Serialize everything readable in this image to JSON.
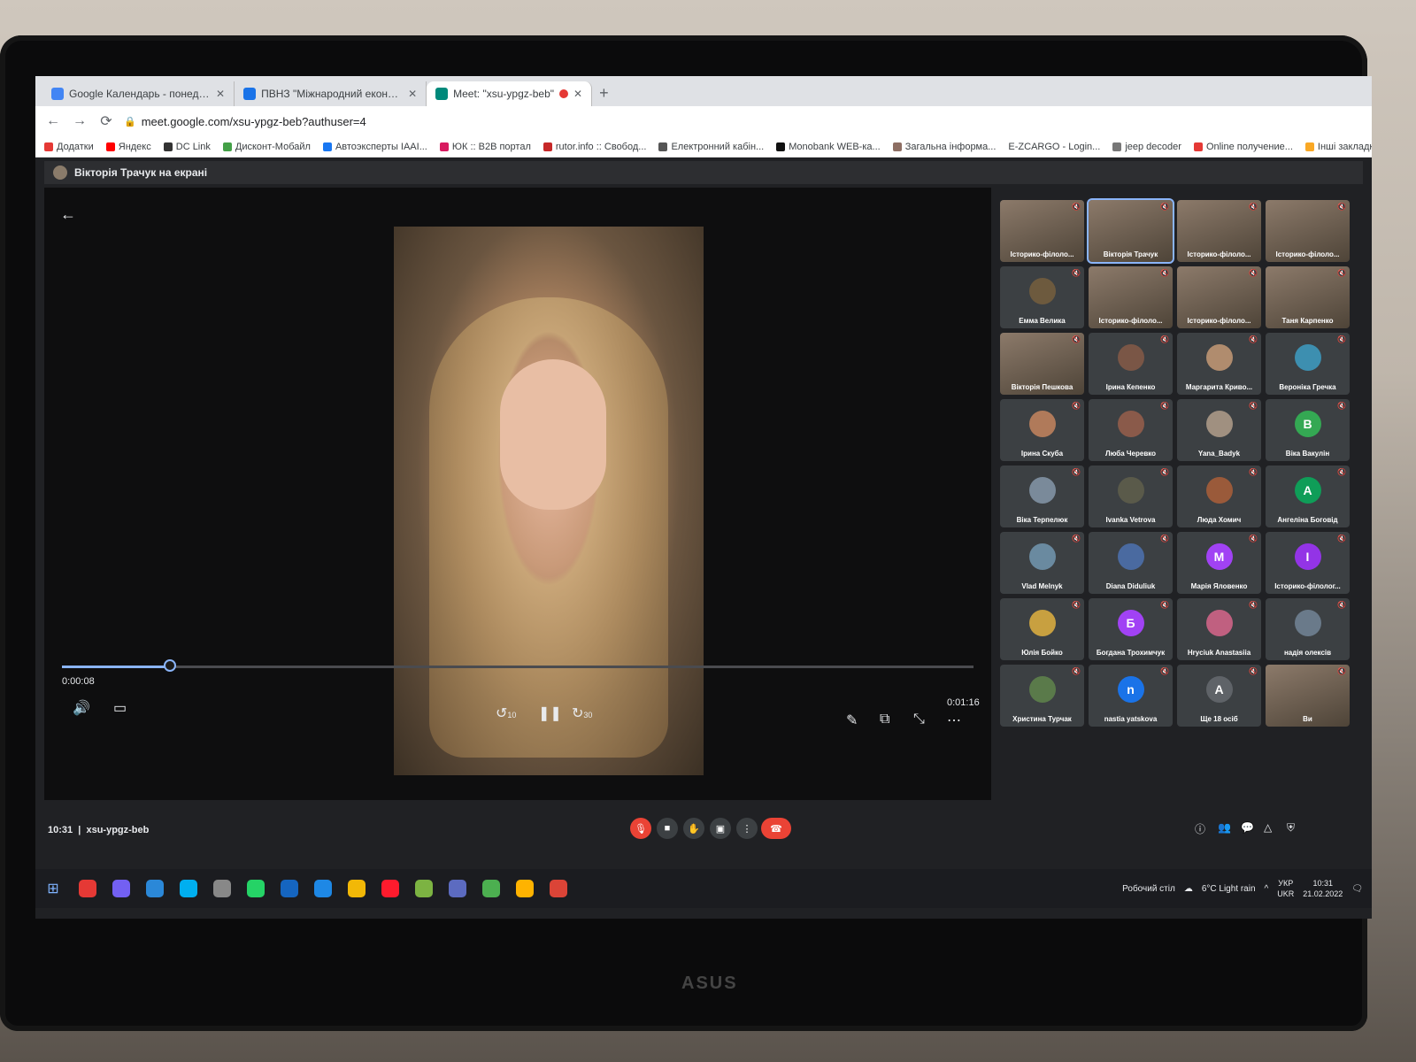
{
  "browser": {
    "tabs": [
      {
        "title": "Google Календарь - понедельн...",
        "color": "#4285f4"
      },
      {
        "title": "ПВНЗ \"Міжнародний економіко...",
        "color": "#1a73e8"
      },
      {
        "title": "Meet: \"xsu-ypgz-beb\"",
        "color": "#00897b"
      }
    ],
    "url": "meet.google.com/xsu-ypgz-beb?authuser=4",
    "bookmarks": [
      "Додатки",
      "Яндекс",
      "DC Link",
      "Дисконт-Мобайл",
      "Автоэксперты IAAI...",
      "ЮК :: B2B портал",
      "rutor.info :: Свобод...",
      "Електронний кабін...",
      "Monobank WEB-ка...",
      "Загальна інформа...",
      "E-ZCARGO - Login...",
      "jeep decoder",
      "Online получение...",
      "Інші закладки"
    ]
  },
  "meet": {
    "presenter_label": "Вікторія Трачук на екрані",
    "player": {
      "current": "0:00:08",
      "total": "0:01:16",
      "progress": 0.118,
      "skip_back": "10",
      "skip_fwd": "30"
    },
    "clock": "10:31",
    "meeting_code": "xsu-ypgz-beb",
    "participants": [
      {
        "name": "Історико-філоло...",
        "cam": true
      },
      {
        "name": "Вікторія Трачук",
        "cam": true,
        "selected": true
      },
      {
        "name": "Історико-філоло...",
        "cam": true
      },
      {
        "name": "Історико-філоло...",
        "cam": true
      },
      {
        "name": "Емма Велика",
        "color": "#6d5a3e"
      },
      {
        "name": "Історико-філоло...",
        "cam": true
      },
      {
        "name": "Історико-філоло...",
        "cam": true
      },
      {
        "name": "Таня Карпенко",
        "cam": true
      },
      {
        "name": "Вікторія Пешкова",
        "cam": true
      },
      {
        "name": "Ірина Кепенко",
        "color": "#7a5646"
      },
      {
        "name": "Маргарита Криво...",
        "color": "#b08c6e"
      },
      {
        "name": "Вероніка Гречка",
        "color": "#3d8fb0"
      },
      {
        "name": "Ірина Скуба",
        "color": "#b07a5a"
      },
      {
        "name": "Люба Черевко",
        "color": "#8a5a4a"
      },
      {
        "name": "Yana_Badyk",
        "color": "#a09080"
      },
      {
        "name": "Віка Вакулін",
        "letter": "В",
        "color": "#34a853"
      },
      {
        "name": "Віка Терпелюк",
        "color": "#7a8a9a"
      },
      {
        "name": "Ivanka Vetrova",
        "color": "#5a5a4a"
      },
      {
        "name": "Люда Хомич",
        "color": "#9a5a3a"
      },
      {
        "name": "Ангеліна Боговід",
        "letter": "А",
        "color": "#0f9d58"
      },
      {
        "name": "Vlad Melnyk",
        "color": "#6a8aa0"
      },
      {
        "name": "Diana Diduliuk",
        "color": "#4a6aa0"
      },
      {
        "name": "Марія Яловенко",
        "letter": "M",
        "color": "#a142f4"
      },
      {
        "name": "Історико-філолог...",
        "letter": "І",
        "color": "#9334e6"
      },
      {
        "name": "Юлія Бойко",
        "color": "#c8a040"
      },
      {
        "name": "Богдана Трохимчук",
        "letter": "Б",
        "color": "#a142f4"
      },
      {
        "name": "Hryciuk Anastasiia",
        "color": "#c06080"
      },
      {
        "name": "надія олексів",
        "color": "#6a7a8a"
      },
      {
        "name": "Христина Турчак",
        "color": "#5a7a4a"
      },
      {
        "name": "nastia yatskova",
        "letter": "n",
        "color": "#1a73e8"
      },
      {
        "name": "Ще 18 осіб",
        "letter": "A",
        "color": "#5f6368"
      },
      {
        "name": "Ви",
        "cam": true
      }
    ]
  },
  "taskbar": {
    "apps": [
      "#e53935",
      "#7360f2",
      "#2b88d8",
      "#00aff0",
      "#888888",
      "#25d366",
      "#1565c0",
      "#1e88e5",
      "#f2b807",
      "#ff1b2d",
      "#7cb342",
      "#5c6bc0",
      "#4caf50",
      "#ffb300",
      "#db4437"
    ],
    "desktop_label": "Робочий стіл",
    "weather": "6°C  Light rain",
    "lang": "УКР",
    "lang2": "UKR",
    "time": "10:31",
    "date": "21.02.2022"
  },
  "brand": "ASUS"
}
